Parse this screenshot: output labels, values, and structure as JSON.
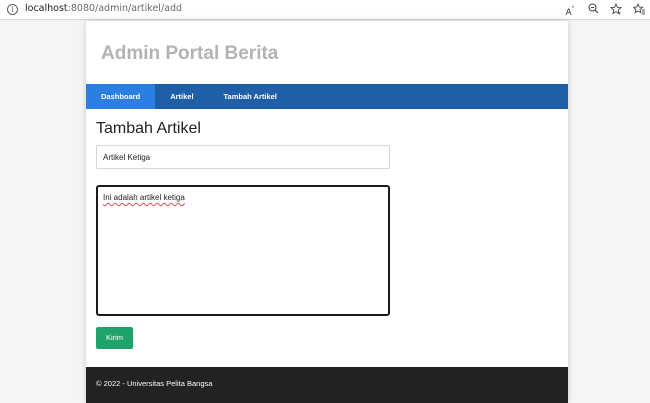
{
  "browser": {
    "info_icon": "info-icon",
    "url_host": "localhost",
    "url_path": ":8080/admin/artikel/add",
    "icons": [
      "read-aloud-icon",
      "zoom-out-icon",
      "favorite-add-icon",
      "favorites-icon"
    ]
  },
  "site": {
    "title": "Admin Portal Berita"
  },
  "nav": {
    "items": [
      {
        "label": "Dashboard",
        "active": true
      },
      {
        "label": "Artikel",
        "active": false
      },
      {
        "label": "Tambah Artikel",
        "active": false
      }
    ]
  },
  "form": {
    "heading": "Tambah Artikel",
    "title_value": "Artikel Ketiga",
    "content_value": "Ini adalah artikel ketiga",
    "submit_label": "Kirim"
  },
  "footer": {
    "text": "© 2022 - Universitas Pelita Bangsa"
  },
  "colors": {
    "nav_bg": "#1f5fa8",
    "nav_active": "#2a7fe0",
    "submit": "#1fa36b",
    "footer_bg": "#222222",
    "title_text": "#b3b3b3"
  }
}
